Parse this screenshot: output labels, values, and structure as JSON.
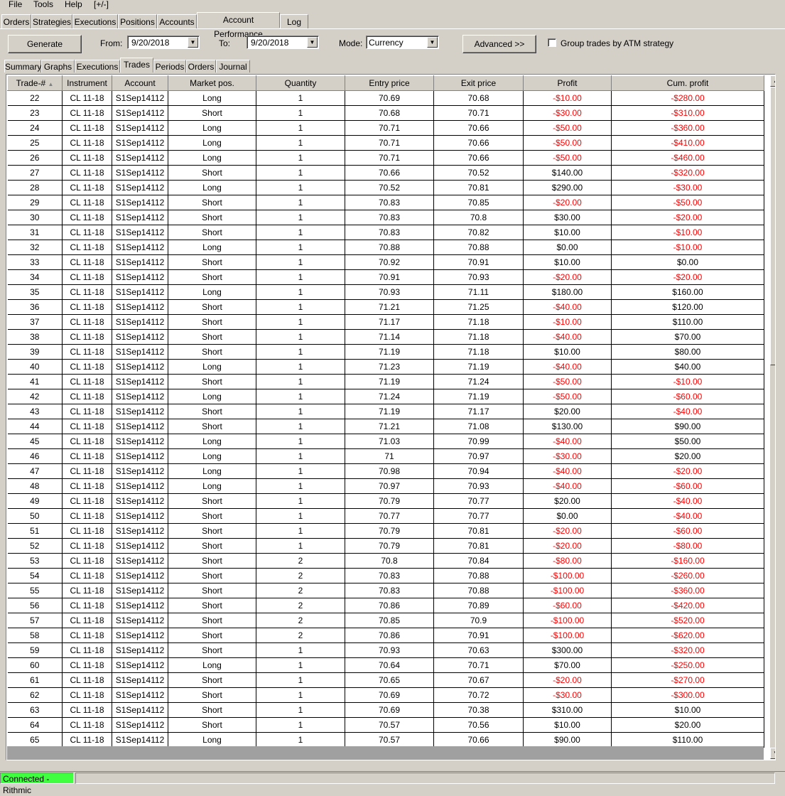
{
  "menu": [
    "File",
    "Tools",
    "Help",
    "[+/-]"
  ],
  "main_tabs": [
    "Orders",
    "Strategies",
    "Executions",
    "Positions",
    "Accounts",
    "Account Performance",
    "Log"
  ],
  "main_tab_active": "Account Performance",
  "toolbar": {
    "generate_label": "Generate",
    "from_label": "From:",
    "from_value": "9/20/2018",
    "to_label": "To:",
    "to_value": "9/20/2018",
    "mode_label": "Mode:",
    "mode_value": "Currency",
    "advanced_label": "Advanced >>",
    "group_trades_label": "Group trades by ATM strategy"
  },
  "sub_tabs": [
    "Summary",
    "Graphs",
    "Executions",
    "Trades",
    "Periods",
    "Orders",
    "Journal"
  ],
  "sub_tab_active": "Trades",
  "columns": [
    "Trade-#",
    "Instrument",
    "Account",
    "Market pos.",
    "Quantity",
    "Entry price",
    "Exit price",
    "Profit",
    "Cum. profit"
  ],
  "sort_indicator": "▲",
  "rows": [
    [
      "22",
      "CL 11-18",
      "S1Sep14112",
      "Long",
      "1",
      "70.69",
      "70.68",
      "-$10.00",
      "-$280.00"
    ],
    [
      "23",
      "CL 11-18",
      "S1Sep14112",
      "Short",
      "1",
      "70.68",
      "70.71",
      "-$30.00",
      "-$310.00"
    ],
    [
      "24",
      "CL 11-18",
      "S1Sep14112",
      "Long",
      "1",
      "70.71",
      "70.66",
      "-$50.00",
      "-$360.00"
    ],
    [
      "25",
      "CL 11-18",
      "S1Sep14112",
      "Long",
      "1",
      "70.71",
      "70.66",
      "-$50.00",
      "-$410.00"
    ],
    [
      "26",
      "CL 11-18",
      "S1Sep14112",
      "Long",
      "1",
      "70.71",
      "70.66",
      "-$50.00",
      "-$460.00"
    ],
    [
      "27",
      "CL 11-18",
      "S1Sep14112",
      "Short",
      "1",
      "70.66",
      "70.52",
      "$140.00",
      "-$320.00"
    ],
    [
      "28",
      "CL 11-18",
      "S1Sep14112",
      "Long",
      "1",
      "70.52",
      "70.81",
      "$290.00",
      "-$30.00"
    ],
    [
      "29",
      "CL 11-18",
      "S1Sep14112",
      "Short",
      "1",
      "70.83",
      "70.85",
      "-$20.00",
      "-$50.00"
    ],
    [
      "30",
      "CL 11-18",
      "S1Sep14112",
      "Short",
      "1",
      "70.83",
      "70.8",
      "$30.00",
      "-$20.00"
    ],
    [
      "31",
      "CL 11-18",
      "S1Sep14112",
      "Short",
      "1",
      "70.83",
      "70.82",
      "$10.00",
      "-$10.00"
    ],
    [
      "32",
      "CL 11-18",
      "S1Sep14112",
      "Long",
      "1",
      "70.88",
      "70.88",
      "$0.00",
      "-$10.00"
    ],
    [
      "33",
      "CL 11-18",
      "S1Sep14112",
      "Short",
      "1",
      "70.92",
      "70.91",
      "$10.00",
      "$0.00"
    ],
    [
      "34",
      "CL 11-18",
      "S1Sep14112",
      "Short",
      "1",
      "70.91",
      "70.93",
      "-$20.00",
      "-$20.00"
    ],
    [
      "35",
      "CL 11-18",
      "S1Sep14112",
      "Long",
      "1",
      "70.93",
      "71.11",
      "$180.00",
      "$160.00"
    ],
    [
      "36",
      "CL 11-18",
      "S1Sep14112",
      "Short",
      "1",
      "71.21",
      "71.25",
      "-$40.00",
      "$120.00"
    ],
    [
      "37",
      "CL 11-18",
      "S1Sep14112",
      "Short",
      "1",
      "71.17",
      "71.18",
      "-$10.00",
      "$110.00"
    ],
    [
      "38",
      "CL 11-18",
      "S1Sep14112",
      "Short",
      "1",
      "71.14",
      "71.18",
      "-$40.00",
      "$70.00"
    ],
    [
      "39",
      "CL 11-18",
      "S1Sep14112",
      "Short",
      "1",
      "71.19",
      "71.18",
      "$10.00",
      "$80.00"
    ],
    [
      "40",
      "CL 11-18",
      "S1Sep14112",
      "Long",
      "1",
      "71.23",
      "71.19",
      "-$40.00",
      "$40.00"
    ],
    [
      "41",
      "CL 11-18",
      "S1Sep14112",
      "Short",
      "1",
      "71.19",
      "71.24",
      "-$50.00",
      "-$10.00"
    ],
    [
      "42",
      "CL 11-18",
      "S1Sep14112",
      "Long",
      "1",
      "71.24",
      "71.19",
      "-$50.00",
      "-$60.00"
    ],
    [
      "43",
      "CL 11-18",
      "S1Sep14112",
      "Short",
      "1",
      "71.19",
      "71.17",
      "$20.00",
      "-$40.00"
    ],
    [
      "44",
      "CL 11-18",
      "S1Sep14112",
      "Short",
      "1",
      "71.21",
      "71.08",
      "$130.00",
      "$90.00"
    ],
    [
      "45",
      "CL 11-18",
      "S1Sep14112",
      "Long",
      "1",
      "71.03",
      "70.99",
      "-$40.00",
      "$50.00"
    ],
    [
      "46",
      "CL 11-18",
      "S1Sep14112",
      "Long",
      "1",
      "71",
      "70.97",
      "-$30.00",
      "$20.00"
    ],
    [
      "47",
      "CL 11-18",
      "S1Sep14112",
      "Long",
      "1",
      "70.98",
      "70.94",
      "-$40.00",
      "-$20.00"
    ],
    [
      "48",
      "CL 11-18",
      "S1Sep14112",
      "Long",
      "1",
      "70.97",
      "70.93",
      "-$40.00",
      "-$60.00"
    ],
    [
      "49",
      "CL 11-18",
      "S1Sep14112",
      "Short",
      "1",
      "70.79",
      "70.77",
      "$20.00",
      "-$40.00"
    ],
    [
      "50",
      "CL 11-18",
      "S1Sep14112",
      "Short",
      "1",
      "70.77",
      "70.77",
      "$0.00",
      "-$40.00"
    ],
    [
      "51",
      "CL 11-18",
      "S1Sep14112",
      "Short",
      "1",
      "70.79",
      "70.81",
      "-$20.00",
      "-$60.00"
    ],
    [
      "52",
      "CL 11-18",
      "S1Sep14112",
      "Short",
      "1",
      "70.79",
      "70.81",
      "-$20.00",
      "-$80.00"
    ],
    [
      "53",
      "CL 11-18",
      "S1Sep14112",
      "Short",
      "2",
      "70.8",
      "70.84",
      "-$80.00",
      "-$160.00"
    ],
    [
      "54",
      "CL 11-18",
      "S1Sep14112",
      "Short",
      "2",
      "70.83",
      "70.88",
      "-$100.00",
      "-$260.00"
    ],
    [
      "55",
      "CL 11-18",
      "S1Sep14112",
      "Short",
      "2",
      "70.83",
      "70.88",
      "-$100.00",
      "-$360.00"
    ],
    [
      "56",
      "CL 11-18",
      "S1Sep14112",
      "Short",
      "2",
      "70.86",
      "70.89",
      "-$60.00",
      "-$420.00"
    ],
    [
      "57",
      "CL 11-18",
      "S1Sep14112",
      "Short",
      "2",
      "70.85",
      "70.9",
      "-$100.00",
      "-$520.00"
    ],
    [
      "58",
      "CL 11-18",
      "S1Sep14112",
      "Short",
      "2",
      "70.86",
      "70.91",
      "-$100.00",
      "-$620.00"
    ],
    [
      "59",
      "CL 11-18",
      "S1Sep14112",
      "Short",
      "1",
      "70.93",
      "70.63",
      "$300.00",
      "-$320.00"
    ],
    [
      "60",
      "CL 11-18",
      "S1Sep14112",
      "Long",
      "1",
      "70.64",
      "70.71",
      "$70.00",
      "-$250.00"
    ],
    [
      "61",
      "CL 11-18",
      "S1Sep14112",
      "Short",
      "1",
      "70.65",
      "70.67",
      "-$20.00",
      "-$270.00"
    ],
    [
      "62",
      "CL 11-18",
      "S1Sep14112",
      "Short",
      "1",
      "70.69",
      "70.72",
      "-$30.00",
      "-$300.00"
    ],
    [
      "63",
      "CL 11-18",
      "S1Sep14112",
      "Short",
      "1",
      "70.69",
      "70.38",
      "$310.00",
      "$10.00"
    ],
    [
      "64",
      "CL 11-18",
      "S1Sep14112",
      "Short",
      "1",
      "70.57",
      "70.56",
      "$10.00",
      "$20.00"
    ],
    [
      "65",
      "CL 11-18",
      "S1Sep14112",
      "Long",
      "1",
      "70.57",
      "70.66",
      "$90.00",
      "$110.00"
    ]
  ],
  "colors": {
    "negative": "#ff0000",
    "connected": "#40ff40"
  },
  "status": {
    "connection": "Connected - Rithmic"
  }
}
